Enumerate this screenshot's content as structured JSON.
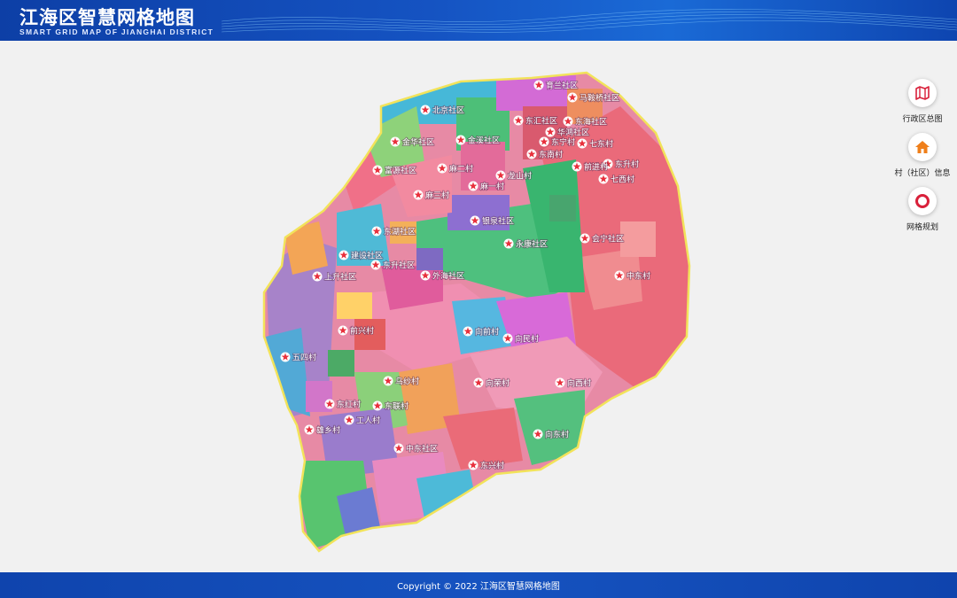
{
  "header": {
    "title": "江海区智慧网格地图",
    "subtitle": "SMART GRID MAP OF JIANGHAI DISTRICT"
  },
  "tools": [
    {
      "label": "行政区总图",
      "icon": "map-icon"
    },
    {
      "label": "村（社区）信息",
      "icon": "house-icon"
    },
    {
      "label": "网格规划",
      "icon": "ring-icon"
    }
  ],
  "map": {
    "labels": [
      "育兰社区",
      "马鞍桥社区",
      "北京社区",
      "东汇社区",
      "东海社区",
      "华鸿社区",
      "七东村",
      "东宁村",
      "金华社区",
      "金溪社区",
      "东升村",
      "东南村",
      "前进村",
      "七西村",
      "富源社区",
      "麻二村",
      "麻一村",
      "龙山村",
      "麻三村",
      "银泉社区",
      "永康社区",
      "会宁社区",
      "中东村",
      "建设社区",
      "东升社区",
      "上升社区",
      "外海社区",
      "东湖社区",
      "五四村",
      "前兴村",
      "向前村",
      "向民村",
      "向荣村",
      "乌纱村",
      "东联村",
      "东红村",
      "工人村",
      "雄乡村",
      "中东社区",
      "向东村",
      "东兴村",
      "向西村"
    ]
  },
  "footer": {
    "copyright": "Copyright © 2022 江海区智慧网格地图"
  },
  "colors": {
    "header_blue": "#1553c2",
    "footer_blue": "#1653c0",
    "marker_red": "#e8303c",
    "boundary_yellow": "#f2e35a"
  }
}
